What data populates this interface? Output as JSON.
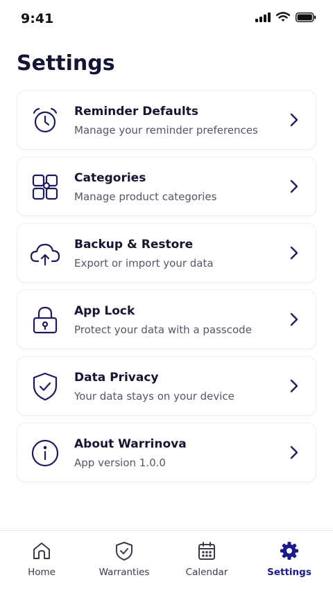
{
  "status_bar": {
    "time": "9:41"
  },
  "page": {
    "title": "Settings"
  },
  "colors": {
    "accent": "#1c1a8a",
    "icon_stroke": "#1c1a5e",
    "text": "#141433",
    "subtext": "#55556a"
  },
  "settings": [
    {
      "title": "Reminder Defaults",
      "subtitle": "Manage your reminder preferences",
      "icon": "alarm-clock-icon"
    },
    {
      "title": "Categories",
      "subtitle": "Manage product categories",
      "icon": "categories-icon"
    },
    {
      "title": "Backup & Restore",
      "subtitle": "Export or import your data",
      "icon": "cloud-upload-icon"
    },
    {
      "title": "App Lock",
      "subtitle": "Protect your data with a passcode",
      "icon": "lock-icon"
    },
    {
      "title": "Data Privacy",
      "subtitle": "Your data stays on your device",
      "icon": "shield-check-icon"
    },
    {
      "title": "About Warrinova",
      "subtitle": "App version 1.0.0",
      "icon": "info-icon"
    }
  ],
  "tab_bar": {
    "tabs": [
      {
        "label": "Home",
        "icon": "home-icon",
        "active": false
      },
      {
        "label": "Warranties",
        "icon": "shield-check-icon",
        "active": false
      },
      {
        "label": "Calendar",
        "icon": "calendar-icon",
        "active": false
      },
      {
        "label": "Settings",
        "icon": "gear-icon",
        "active": true
      }
    ]
  }
}
